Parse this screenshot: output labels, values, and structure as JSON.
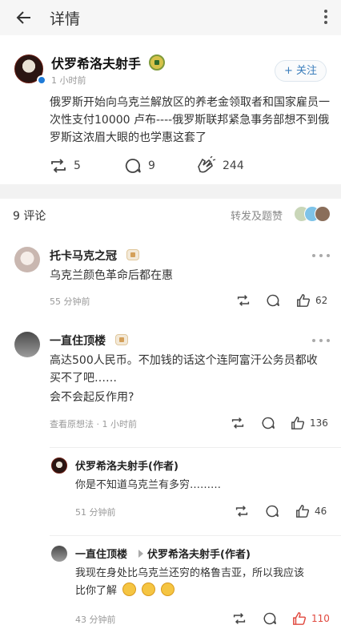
{
  "topbar": {
    "title": "详情"
  },
  "post": {
    "author": "伏罗希洛夫射手",
    "time": "1 小时前",
    "follow_label": "关注",
    "text": "俄罗斯开始向乌克兰解放区的养老金领取者和国家雇员一次性支付10000 卢布----俄罗斯联邦紧急事务部想不到俄罗斯这浓眉大眼的也学惠这套了",
    "reposts": "5",
    "comments": "9",
    "likes": "244"
  },
  "comments_header": {
    "count_label": "9 评论",
    "repost_label": "转发及题赞"
  },
  "comments": [
    {
      "name": "托卡马克之冠",
      "text": "乌克兰颜色革命后都在惠",
      "time": "55 分钟前",
      "likes": "62"
    },
    {
      "name": "一直住顶楼",
      "text_lines": [
        "高达500人民币。不加钱的话这个连阿富汗公务员都收",
        "买不了吧……",
        "会不会起反作用?"
      ],
      "view_image": "查看原想法",
      "time": "1 小时前",
      "likes": "136"
    }
  ],
  "replies": [
    {
      "name": "伏罗希洛夫射手(作者)",
      "text": "你是不知道乌克兰有多穷………",
      "time": "51 分钟前",
      "likes": "46"
    },
    {
      "name": "一直住顶楼",
      "reply_to": "伏罗希洛夫射手(作者)",
      "text_lines": [
        "我现在身处比乌克兰还穷的格鲁吉亚，所以我应该",
        "比你了解"
      ],
      "time": "43 分钟前",
      "likes": "110"
    }
  ],
  "colors": {
    "accent": "#3a7dbb",
    "liked": "#e0483e",
    "band": "#f2f2f2"
  }
}
